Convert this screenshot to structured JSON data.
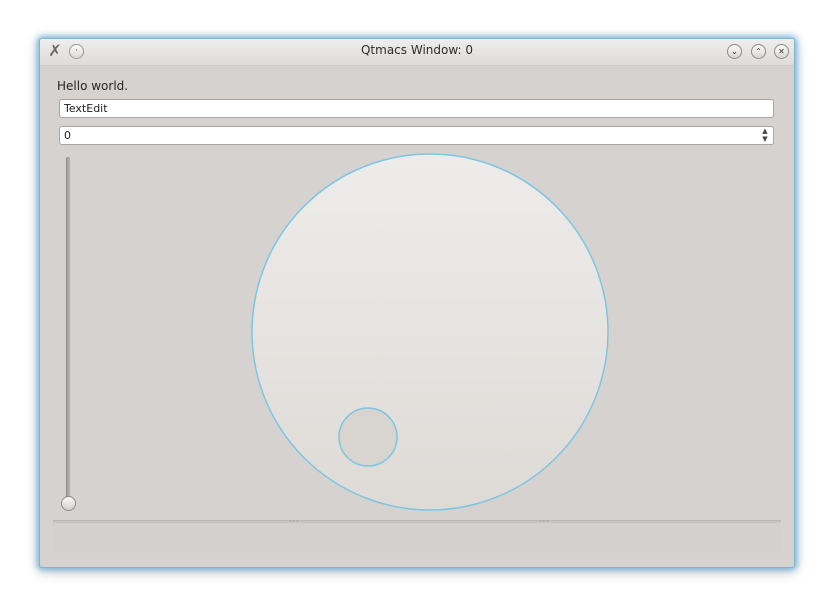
{
  "window": {
    "title": "Qtmacs Window: 0",
    "icons": {
      "app": "x-app-icon",
      "menu": "window-menu-icon",
      "minimize": "chevron-down-icon",
      "maximize": "chevron-up-icon",
      "close": "close-icon"
    }
  },
  "content": {
    "label": "Hello world.",
    "textedit_value": "TextEdit",
    "spinbox_value": "0",
    "slider_value": 0,
    "dial_value": 0
  },
  "colors": {
    "accent": "#6fbfe0",
    "background": "#d6d2cf"
  }
}
